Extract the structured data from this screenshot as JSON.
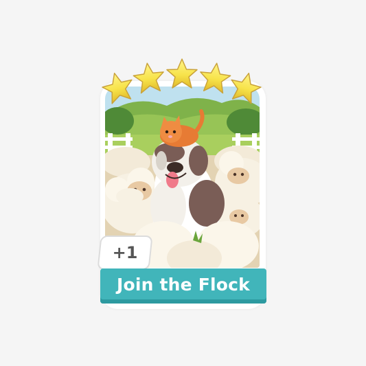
{
  "card": {
    "title": "Join the Flock",
    "bonus": "+1",
    "star_count": 5,
    "star_color": "#f7e34a",
    "banner_color": "#41b5ba"
  },
  "artwork": {
    "icon": "sheepdog-with-cat-and-sheep-illustration"
  }
}
